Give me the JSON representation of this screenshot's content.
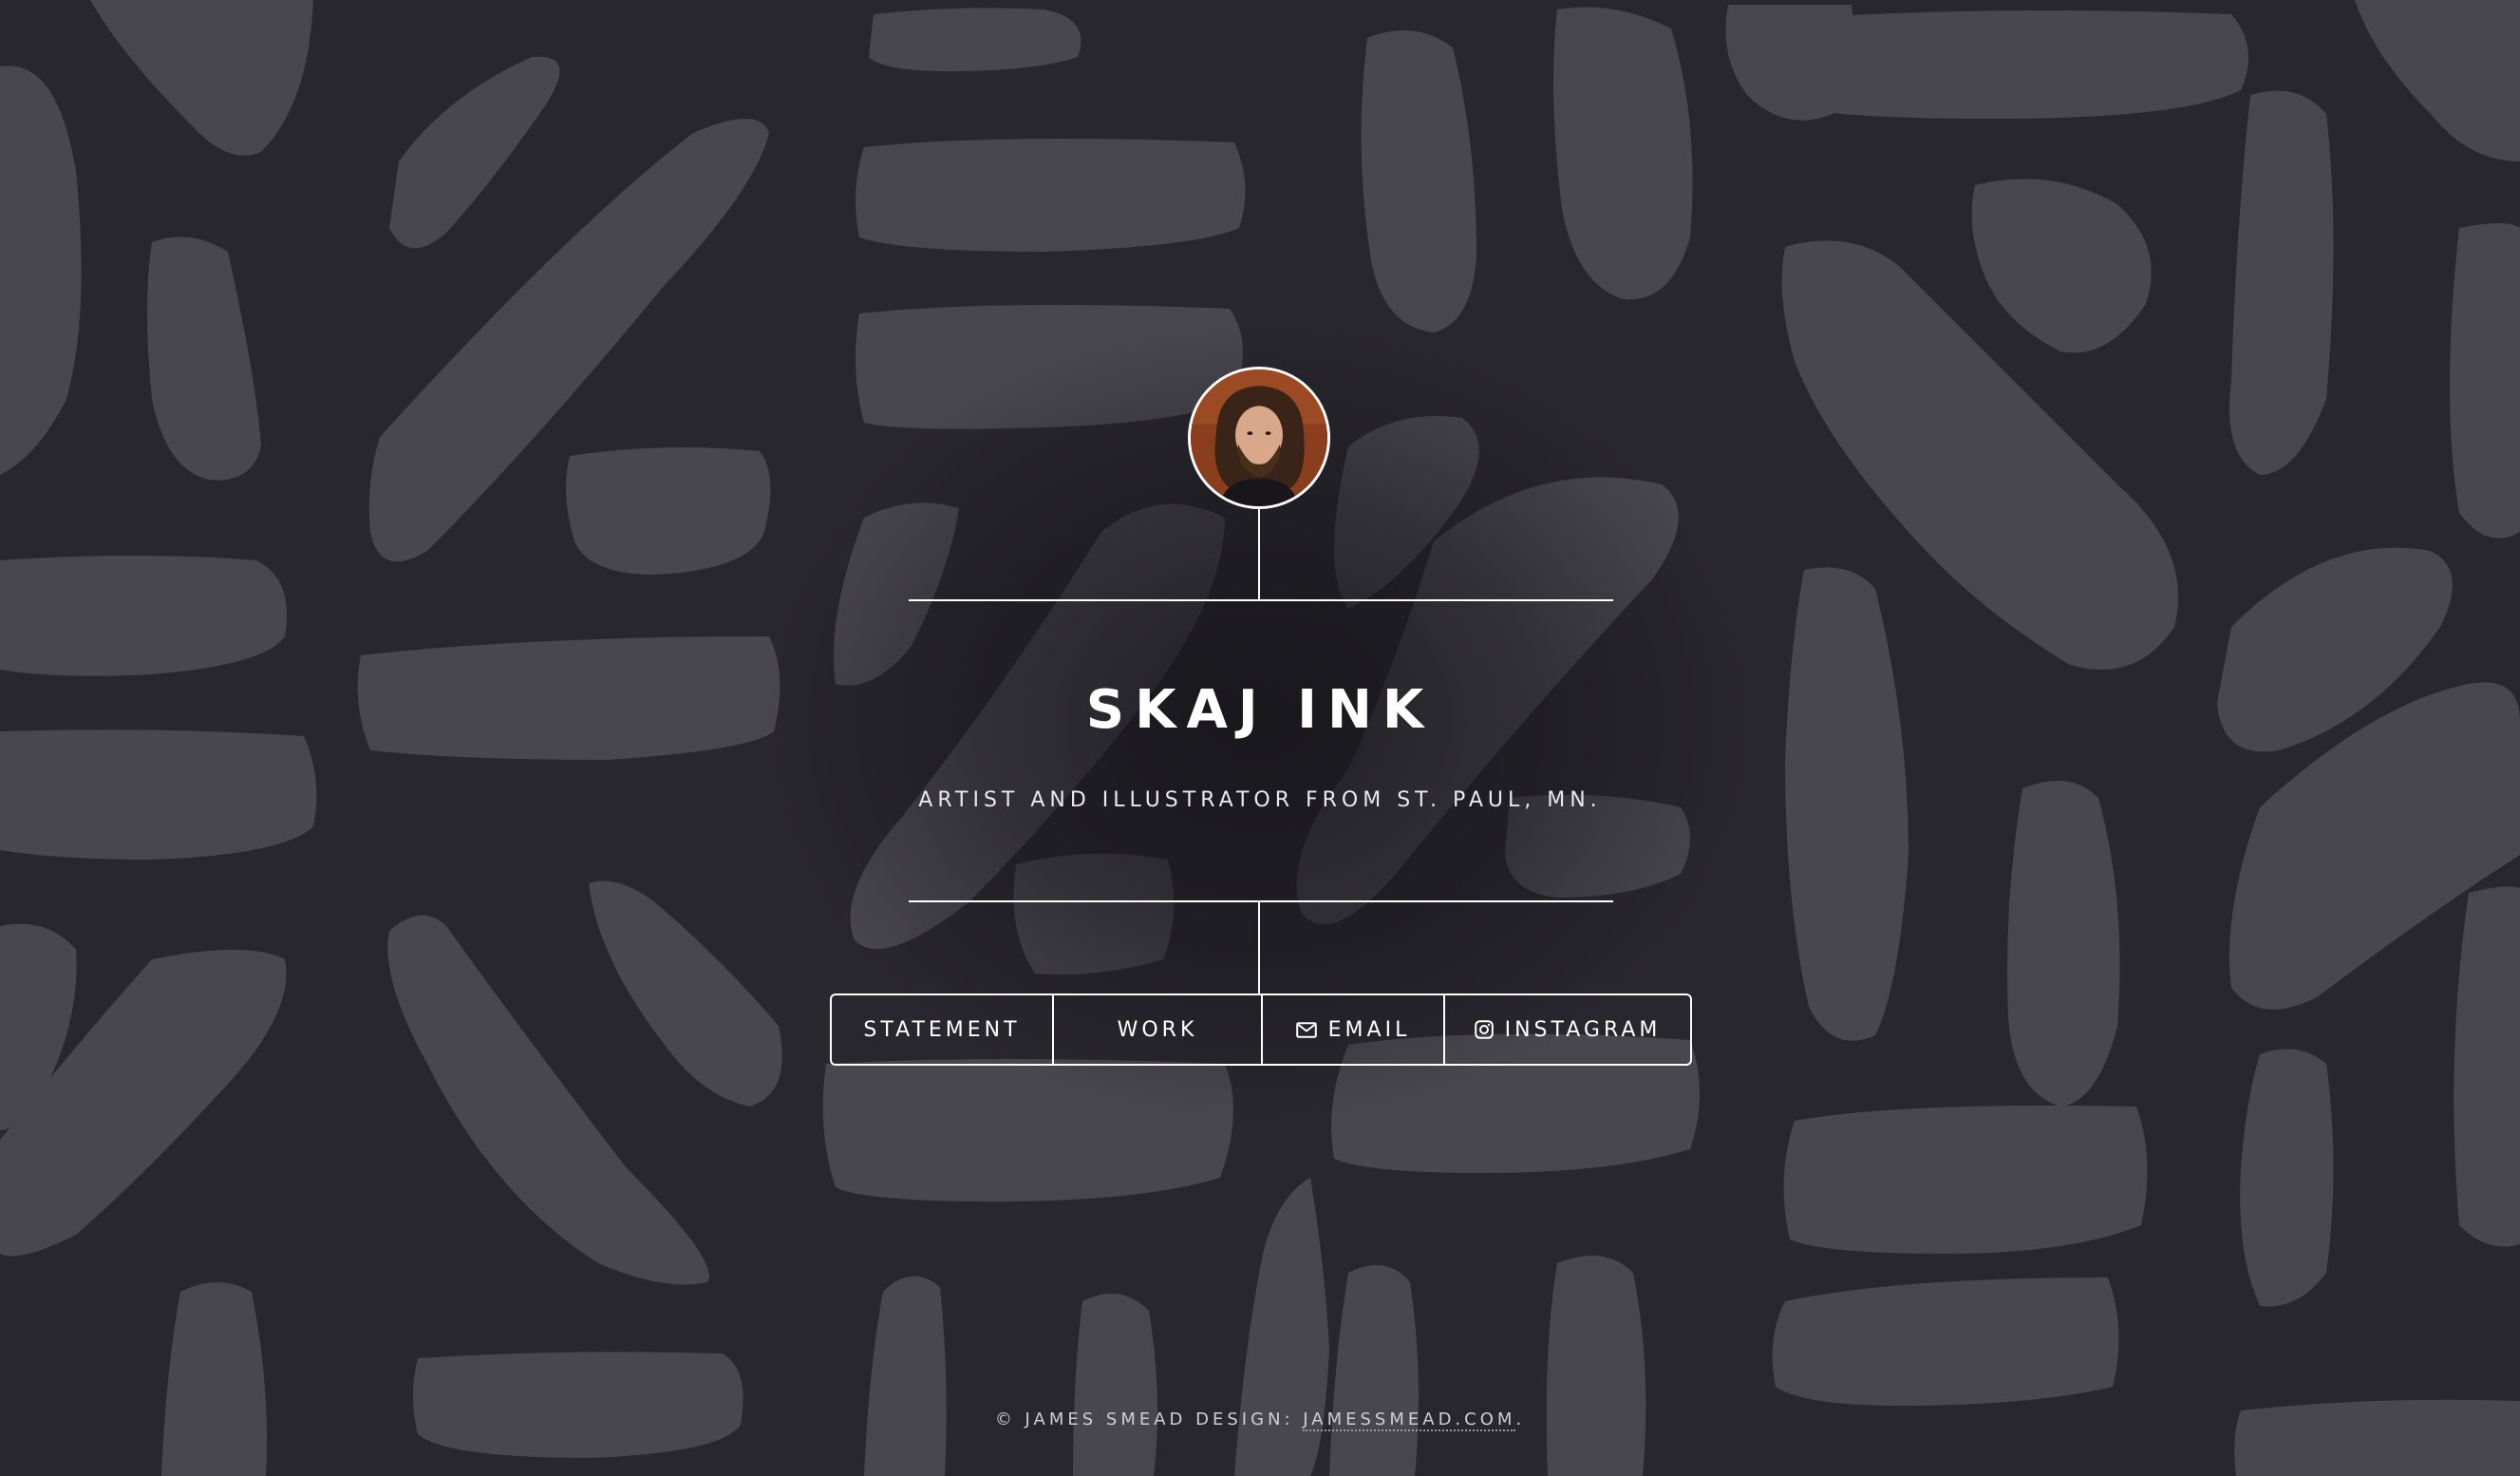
{
  "site": {
    "title": "SKAJ INK",
    "tagline": "ARTIST AND ILLUSTRATOR FROM ST. PAUL, MN."
  },
  "nav": {
    "items": [
      {
        "label": "STATEMENT",
        "icon": ""
      },
      {
        "label": "WORK",
        "icon": ""
      },
      {
        "label": "EMAIL",
        "icon": "envelope-icon"
      },
      {
        "label": "INSTAGRAM",
        "icon": "instagram-icon"
      }
    ]
  },
  "footer": {
    "prefix": "© JAMES SMEAD DESIGN: ",
    "link_text": "JAMESSMEAD.COM",
    "suffix": "."
  },
  "colors": {
    "background": "#28272d",
    "pattern": "#48474d",
    "line": "#ffffff",
    "text": "#ffffff"
  }
}
